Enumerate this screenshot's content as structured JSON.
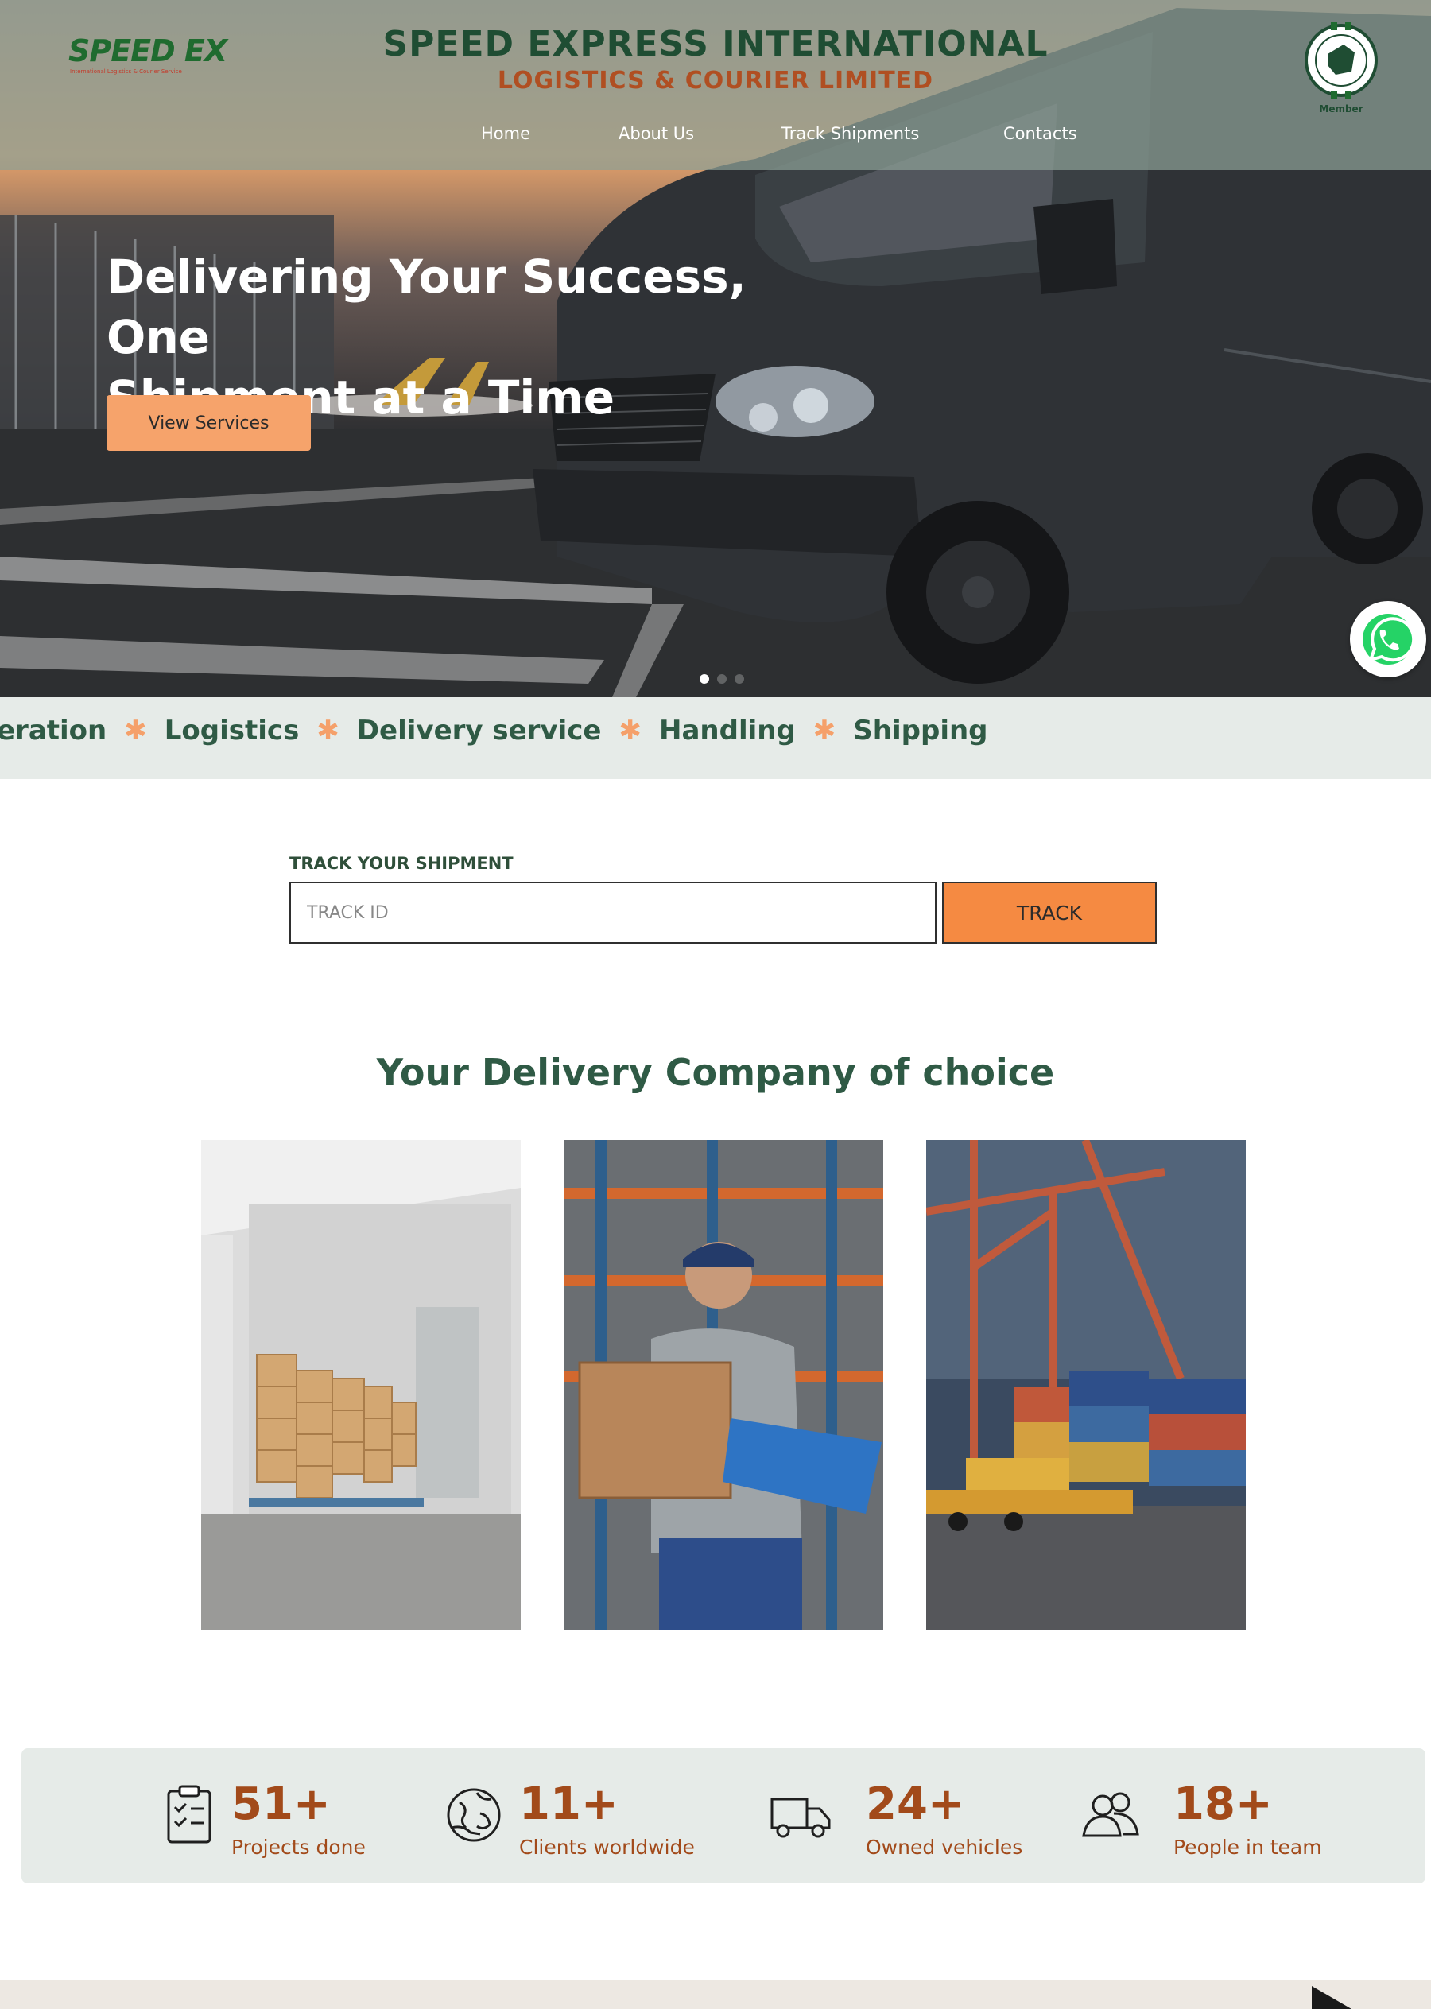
{
  "header": {
    "logo_text": "SPEED EX",
    "logo_tagline": "International Logistics & Courier Service",
    "title": "SPEED EXPRESS INTERNATIONAL",
    "subtitle": "LOGISTICS & COURIER LIMITED",
    "member_label": "Member",
    "nav": [
      {
        "label": "Home"
      },
      {
        "label": "About Us"
      },
      {
        "label": "Track Shipments"
      },
      {
        "label": "Contacts"
      }
    ]
  },
  "hero": {
    "headline_line1": "Delivering Your Success, One",
    "headline_line2": "Shipment at a Time",
    "cta_label": "View Services",
    "slides_total": 3,
    "slide_active": 1
  },
  "ticker": {
    "items": [
      "eration",
      "Logistics",
      "Delivery service",
      "Handling",
      "Shipping"
    ]
  },
  "track": {
    "label": "TRACK YOUR SHIPMENT",
    "placeholder": "TRACK ID",
    "button_label": "TRACK"
  },
  "choice": {
    "title": "Your Delivery Company of choice"
  },
  "stats": [
    {
      "value": "51+",
      "label": "Projects done",
      "icon": "clipboard-check-icon"
    },
    {
      "value": "11+",
      "label": "Clients worldwide",
      "icon": "globe-hand-icon"
    },
    {
      "value": "24+",
      "label": "Owned vehicles",
      "icon": "delivery-truck-icon"
    },
    {
      "value": "18+",
      "label": "People in team",
      "icon": "team-people-icon"
    }
  ],
  "colors": {
    "brand_green": "#1f4d33",
    "accent_orange": "#f58a42",
    "stat_brown": "#a24a1a",
    "panel_gray": "#e6ebe8"
  }
}
